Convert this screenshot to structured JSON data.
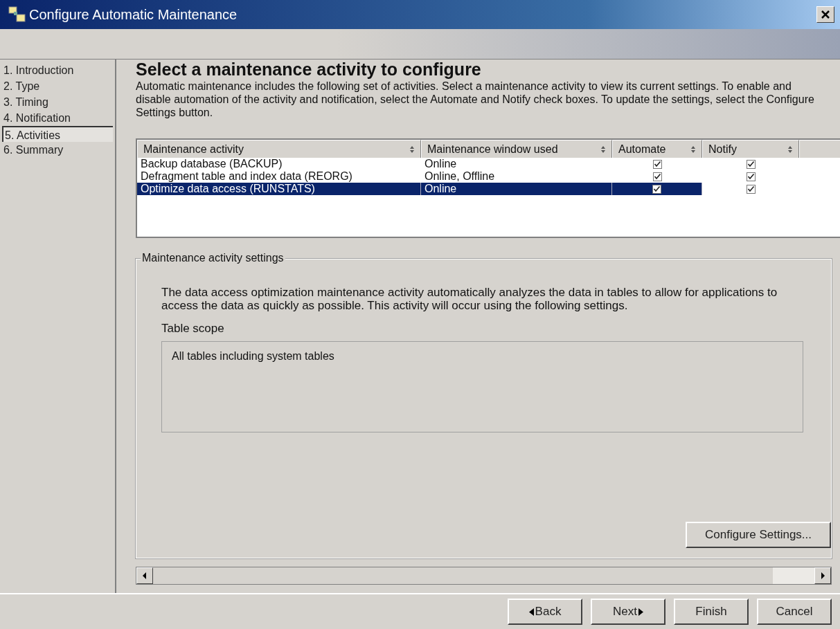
{
  "window": {
    "title": "Configure Automatic Maintenance"
  },
  "steps": [
    {
      "label": "1. Introduction",
      "selected": false
    },
    {
      "label": "2. Type",
      "selected": false
    },
    {
      "label": "3. Timing",
      "selected": false
    },
    {
      "label": "4. Notification",
      "selected": false
    },
    {
      "label": "5. Activities",
      "selected": true
    },
    {
      "label": "6. Summary",
      "selected": false
    }
  ],
  "heading": "Select a maintenance activity to configure",
  "description": "Automatic maintenance includes the following set of activities. Select a maintenance activity to view its current settings. To enable and disable automation of the activity and notification, select the Automate and Notify check boxes. To update the settings, select the Configure Settings button.",
  "table": {
    "columns": [
      "Maintenance activity",
      "Maintenance window used",
      "Automate",
      "Notify"
    ],
    "rows": [
      {
        "activity": "Backup database (BACKUP)",
        "window": "Online",
        "automate": true,
        "notify": true,
        "selected": false
      },
      {
        "activity": "Defragment table and index data (REORG)",
        "window": "Online, Offline",
        "automate": true,
        "notify": true,
        "selected": false
      },
      {
        "activity": "Optimize data access (RUNSTATS)",
        "window": "Online",
        "automate": true,
        "notify": true,
        "selected": true
      }
    ]
  },
  "settings": {
    "legend": "Maintenance activity settings",
    "text": "The data access optimization maintenance activity automatically analyzes the data in tables to allow for applications to access the data as quickly as possible. This activity will occur using the following settings.",
    "scope_label": "Table scope",
    "scope_value": "All tables including system tables",
    "configure_button": "Configure Settings..."
  },
  "buttons": [
    {
      "label": "Back",
      "kind": "back"
    },
    {
      "label": "Next",
      "kind": "next"
    },
    {
      "label": "Finish",
      "kind": "plain"
    },
    {
      "label": "Cancel",
      "kind": "plain"
    }
  ]
}
